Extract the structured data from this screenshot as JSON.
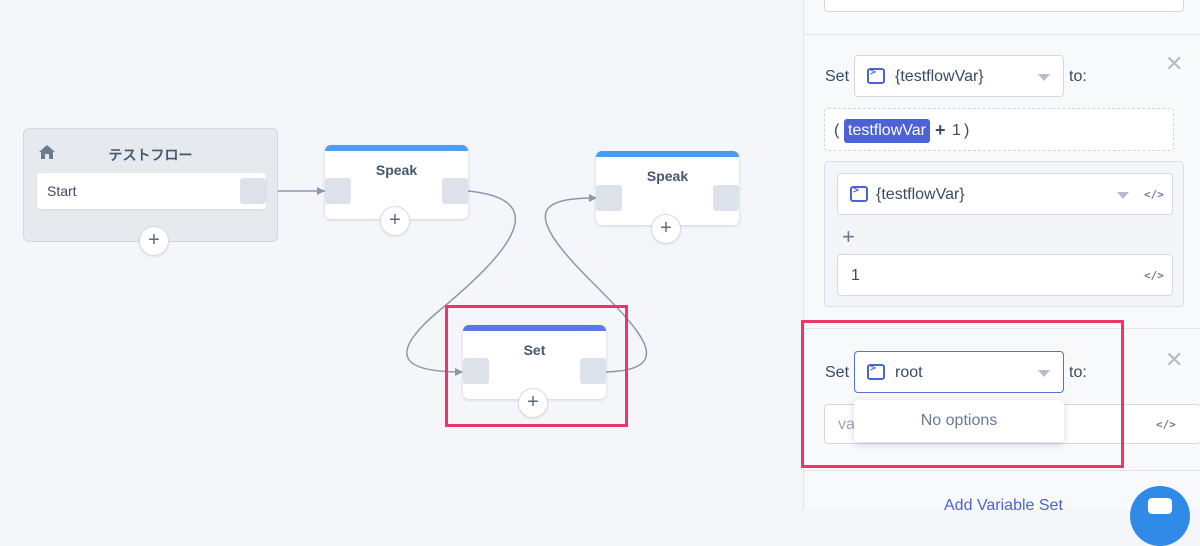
{
  "canvas": {
    "start_node": {
      "title": "テストフロー",
      "entry_label": "Start",
      "add_label": "+"
    },
    "speak_node_1": {
      "title": "Speak",
      "add_label": "+"
    },
    "speak_node_2": {
      "title": "Speak",
      "add_label": "+"
    },
    "set_node": {
      "title": "Set",
      "add_label": "+"
    },
    "colors": {
      "highlight": "#f0336b",
      "speak_header": "#4a9ef0",
      "set_header": "#5a78e6"
    }
  },
  "panel": {
    "set_block_1": {
      "set_label": "Set",
      "to_label": "to:",
      "variable": "{testflowVar}",
      "close_label": "✕",
      "expression": {
        "open": "(",
        "chip": "testflowVar",
        "operator": "+",
        "operand": "1",
        "close": ")"
      },
      "operand_a": "{testflowVar}",
      "plus_label": "+",
      "operand_b": "1",
      "code_label": "</>"
    },
    "set_block_2": {
      "set_label": "Set",
      "to_label": "to:",
      "variable": "root",
      "close_label": "✕",
      "value_placeholder": "va",
      "code_label": "</>",
      "dropdown_empty": "No options"
    },
    "add_variable_set": "Add Variable Set"
  }
}
